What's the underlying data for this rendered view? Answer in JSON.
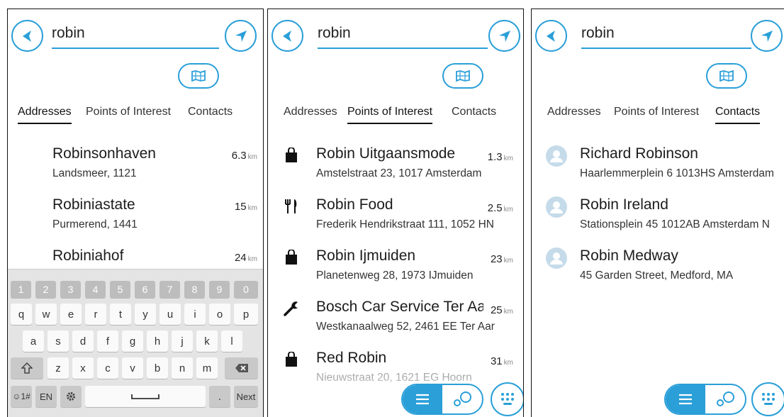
{
  "accent_color": "#2a9fd8",
  "panels": [
    {
      "search_value": "robin",
      "tabs": [
        {
          "label": "Addresses",
          "active": true
        },
        {
          "label": "Points of Interest",
          "active": false
        },
        {
          "label": "Contacts",
          "active": false
        }
      ],
      "results": [
        {
          "name": "Robinsonhaven",
          "address": "Landsmeer, 1121",
          "distance": "6.3",
          "unit": "km"
        },
        {
          "name": "Robiniastate",
          "address": "Purmerend, 1441",
          "distance": "15",
          "unit": "km"
        },
        {
          "name": "Robiniahof",
          "address": "",
          "distance": "24",
          "unit": "km"
        }
      ],
      "keyboard": {
        "numbers": [
          "1",
          "2",
          "3",
          "4",
          "5",
          "6",
          "7",
          "8",
          "9",
          "0"
        ],
        "row1": [
          "q",
          "w",
          "e",
          "r",
          "t",
          "y",
          "u",
          "i",
          "o",
          "p"
        ],
        "row2": [
          "a",
          "s",
          "d",
          "f",
          "g",
          "h",
          "j",
          "k",
          "l"
        ],
        "row3": [
          "z",
          "x",
          "c",
          "v",
          "b",
          "n",
          "m"
        ],
        "sym_label": "☺1#",
        "lang_label": "EN",
        "next_label": "Next"
      }
    },
    {
      "search_value": "robin",
      "tabs": [
        {
          "label": "Addresses",
          "active": false
        },
        {
          "label": "Points of Interest",
          "active": true
        },
        {
          "label": "Contacts",
          "active": false
        }
      ],
      "results": [
        {
          "name": "Robin Uitgaansmode",
          "address": "Amstelstraat 23, 1017 Amsterdam",
          "distance": "1.3",
          "unit": "km",
          "icon": "shopping-bag-icon"
        },
        {
          "name": "Robin Food",
          "address": "Frederik Hendrikstraat 111, 1052 HN",
          "distance": "2.5",
          "unit": "km",
          "icon": "restaurant-icon"
        },
        {
          "name": "Robin Ijmuiden",
          "address": "Planetenweg 28, 1973 IJmuiden",
          "distance": "23",
          "unit": "km",
          "icon": "shopping-bag-icon"
        },
        {
          "name": "Bosch Car Service Ter Aar",
          "address": "Westkanaalweg 52, 2461 EE Ter Aar",
          "distance": "25",
          "unit": "km",
          "icon": "wrench-icon"
        },
        {
          "name": "Red Robin",
          "address": "Nieuwstraat 20, 1621 EG Hoorn",
          "distance": "31",
          "unit": "km",
          "icon": "shopping-bag-icon"
        }
      ]
    },
    {
      "search_value": "robin",
      "tabs": [
        {
          "label": "Addresses",
          "active": false
        },
        {
          "label": "Points of Interest",
          "active": false
        },
        {
          "label": "Contacts",
          "active": true
        }
      ],
      "results": [
        {
          "name": "Richard Robinson",
          "address": "Haarlemmerplein 6 1013HS Amsterdam",
          "icon": "contact-icon"
        },
        {
          "name": "Robin Ireland",
          "address": "Stationsplein 45 1012AB Amsterdam N",
          "icon": "contact-icon"
        },
        {
          "name": "Robin Medway",
          "address": "45 Garden Street, Medford, MA",
          "icon": "contact-icon"
        }
      ]
    }
  ]
}
